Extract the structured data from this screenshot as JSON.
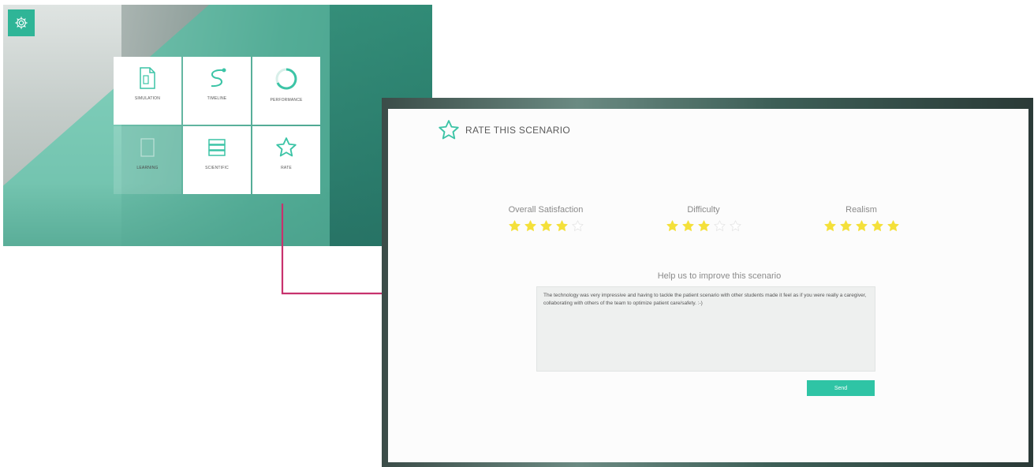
{
  "menu": {
    "tiles": [
      {
        "label": "SIMULATION",
        "icon": "document-icon"
      },
      {
        "label": "TIMELINE",
        "icon": "timeline-path-icon"
      },
      {
        "label": "PERFORMANCE",
        "icon": "performance-ring-icon"
      },
      {
        "label": "LEARNING",
        "icon": "learning-icon"
      },
      {
        "label": "SCIENTIFIC",
        "icon": "book-stack-icon"
      },
      {
        "label": "RATE",
        "icon": "star-outline-icon"
      }
    ]
  },
  "rating": {
    "title": "RATE THIS SCENARIO",
    "criteria": [
      {
        "label": "Overall Satisfaction",
        "rating": 4,
        "max": 5
      },
      {
        "label": "Difficulty",
        "rating": 3,
        "max": 5
      },
      {
        "label": "Realism",
        "rating": 5,
        "max": 5
      }
    ],
    "improve_label": "Help us to improve this scenario",
    "feedback_text": "The technology was very impressive and having to tackle the patient scenario with other students made it feel as if you were really a caregiver, collaborating with others of the team to optimize patient care/safety. :-)",
    "send_label": "Send"
  },
  "colors": {
    "accent": "#2fc4a5",
    "star_filled": "#f4e03a",
    "star_empty": "#e6e6e6",
    "connector": "#c8326e"
  }
}
